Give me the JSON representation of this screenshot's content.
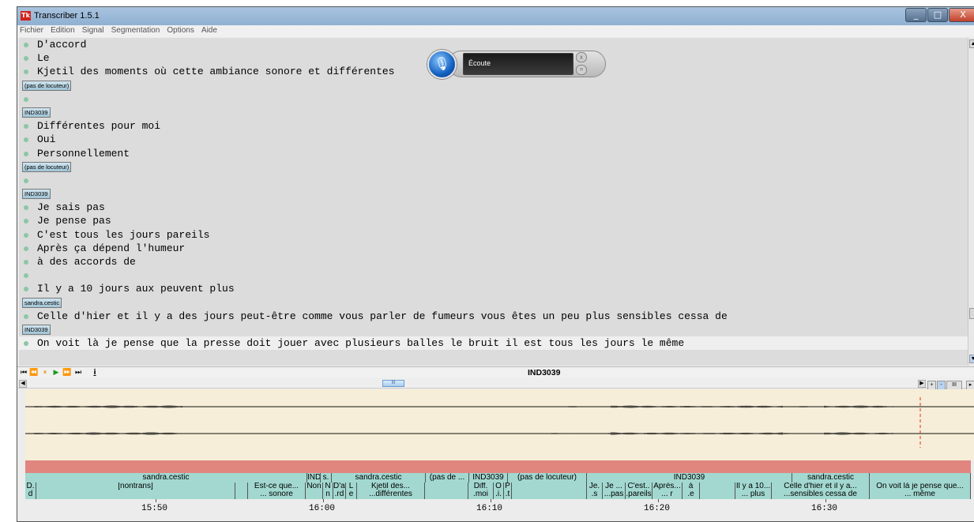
{
  "window": {
    "title": "Transcriber 1.5.1",
    "logo": "Tk"
  },
  "menu": [
    "Fichier",
    "Edition",
    "Signal",
    "Segmentation",
    "Options",
    "Aide"
  ],
  "transcript": [
    {
      "type": "line",
      "text": "D'accord"
    },
    {
      "type": "line",
      "text": "Le"
    },
    {
      "type": "line",
      "text": "Kjetil des moments où cette ambiance sonore et différentes"
    },
    {
      "type": "speaker",
      "text": "(pas de locuteur)"
    },
    {
      "type": "line",
      "text": ""
    },
    {
      "type": "speaker",
      "text": "IND3039"
    },
    {
      "type": "line",
      "text": "Différentes pour moi"
    },
    {
      "type": "line",
      "text": "Oui"
    },
    {
      "type": "line",
      "text": "Personnellement"
    },
    {
      "type": "speaker",
      "text": "(pas de locuteur)"
    },
    {
      "type": "line",
      "text": ""
    },
    {
      "type": "speaker",
      "text": "IND3039"
    },
    {
      "type": "line",
      "text": "Je sais pas"
    },
    {
      "type": "line",
      "text": "Je pense pas"
    },
    {
      "type": "line",
      "text": "C'est tous les jours pareils"
    },
    {
      "type": "line",
      "text": "Après ça dépend l'humeur"
    },
    {
      "type": "line",
      "text": "à des accords de"
    },
    {
      "type": "line",
      "text": ""
    },
    {
      "type": "line",
      "text": "Il y a 10 jours aux peuvent plus"
    },
    {
      "type": "speaker",
      "text": "sandra.cestic"
    },
    {
      "type": "line",
      "text": "Celle d'hier et il y a des jours peut-être comme vous parler de fumeurs vous êtes un peu plus sensibles cessa de"
    },
    {
      "type": "speaker",
      "text": "IND3039"
    },
    {
      "type": "line",
      "text": "On voit là je pense que la presse doit jouer avec plusieurs balles le bruit il est tous les jours le même",
      "selected": true
    }
  ],
  "overlay": {
    "label": "Écoute",
    "close": "x",
    "menu": "="
  },
  "controls": {
    "buttons": [
      "⏮",
      "⏪",
      "⏸",
      "▶",
      "⏩",
      "⏭",
      "i"
    ],
    "current_segment": "IND3039"
  },
  "hscroll": {
    "thumb": "III",
    "left": "◀",
    "right": "▶"
  },
  "zoom": [
    "+",
    "-",
    "III",
    "▸"
  ],
  "speaker_tier": [
    {
      "text": "sandra.cestic"
    },
    {
      "text": "IND..."
    },
    {
      "text": "s."
    },
    {
      "text": "sandra.cestic"
    },
    {
      "text": "(pas de ..."
    },
    {
      "text": "IND3039"
    },
    {
      "text": "(pas de locuteur)"
    },
    {
      "text": "IND3039"
    },
    {
      "text": "sandra.cestic"
    },
    {
      "text": ""
    }
  ],
  "segment_tier": [
    {
      "l1": "D.",
      "l2": "d"
    },
    {
      "l1": "[nontrans]",
      "l2": ""
    },
    {
      "l1": "",
      "l2": ""
    },
    {
      "l1": "Est-ce que...",
      "l2": "... sonore"
    },
    {
      "l1": "Non",
      "l2": ""
    },
    {
      "l1": "N",
      "l2": "n"
    },
    {
      "l1": "D'a.",
      "l2": ".rd"
    },
    {
      "l1": "L",
      "l2": "e"
    },
    {
      "l1": "Kjetil des...",
      "l2": "...différentes"
    },
    {
      "l1": "",
      "l2": ""
    },
    {
      "l1": "Diff.",
      "l2": ".moi"
    },
    {
      "l1": "O",
      "l2": ".i."
    },
    {
      "l1": "P",
      "l2": ".t"
    },
    {
      "l1": "",
      "l2": ""
    },
    {
      "l1": "Je.",
      "l2": ".s"
    },
    {
      "l1": "Je ...",
      "l2": "...pas"
    },
    {
      "l1": "C'est..",
      "l2": ".pareils"
    },
    {
      "l1": "Après...",
      "l2": "... r"
    },
    {
      "l1": "à",
      "l2": ".e"
    },
    {
      "l1": "",
      "l2": ""
    },
    {
      "l1": "Il y a 10...",
      "l2": "... plus"
    },
    {
      "l1": "Celle d'hier et il y a...",
      "l2": "...sensibles cessa de"
    },
    {
      "l1": "On voit là je pense que...",
      "l2": "... même"
    }
  ],
  "time_labels": [
    "15:50",
    "16:00",
    "16:10",
    "16:20",
    "16:30"
  ],
  "colors": {
    "signal_bg": "#f6eed8",
    "segment_bar": "#e0867f",
    "tier_bg": "#a2d8d0",
    "bullet": "#8cc6a4",
    "cursor": "#e0311f",
    "text_bg": "#dcdcdc"
  }
}
